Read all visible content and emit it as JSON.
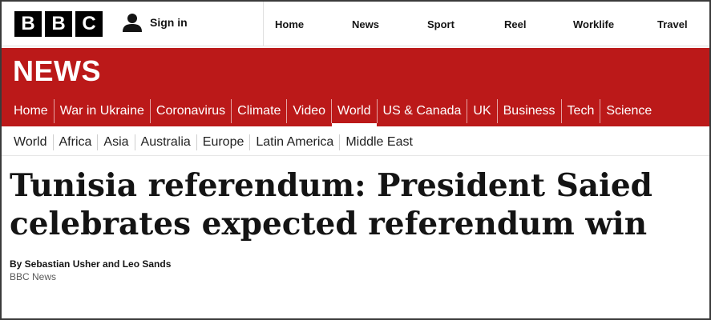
{
  "brand": {
    "logo_letters": [
      "B",
      "B",
      "C"
    ]
  },
  "account": {
    "signin_label": "Sign in"
  },
  "top_nav": [
    "Home",
    "News",
    "Sport",
    "Reel",
    "Worklife",
    "Travel"
  ],
  "section": {
    "title": "NEWS",
    "band_color": "#bb1919"
  },
  "primary_nav": {
    "items": [
      "Home",
      "War in Ukraine",
      "Coronavirus",
      "Climate",
      "Video",
      "World",
      "US & Canada",
      "UK",
      "Business",
      "Tech",
      "Science"
    ],
    "active": "World"
  },
  "secondary_nav": [
    "World",
    "Africa",
    "Asia",
    "Australia",
    "Europe",
    "Latin America",
    "Middle East"
  ],
  "article": {
    "headline": "Tunisia referendum: President Saied celebrates expected referendum win",
    "byline": "By Sebastian Usher and Leo Sands",
    "source": "BBC News"
  }
}
